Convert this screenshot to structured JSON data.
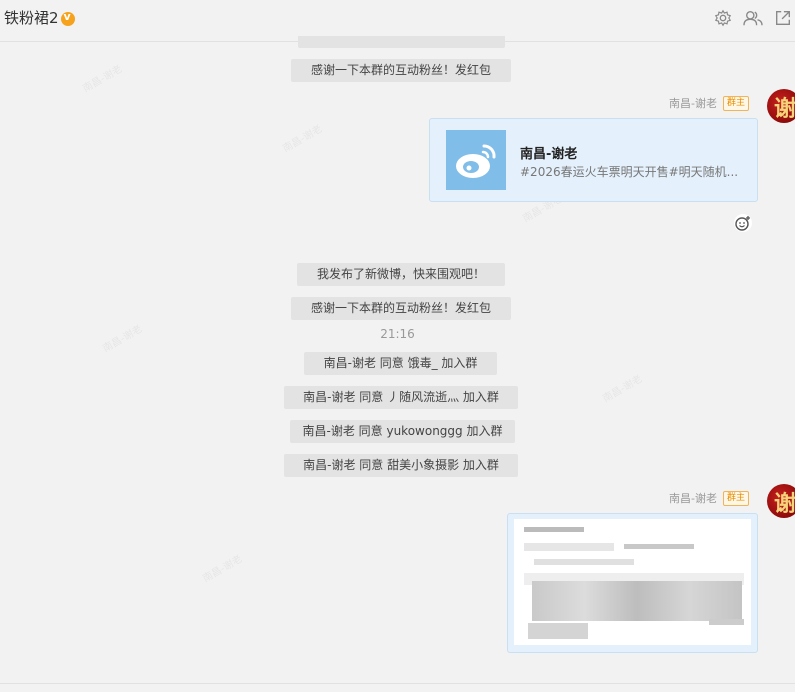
{
  "header": {
    "title": "铁粉裙2",
    "icons": [
      "settings-icon",
      "members-icon",
      "open-external-icon"
    ]
  },
  "messages": {
    "sys1": "感谢一下本群的互动粉丝！发红包",
    "sender1": "南昌-谢老",
    "role1": "群主",
    "avatar_text": "谢",
    "card": {
      "name": "南昌-谢老",
      "desc": "#2026春运火车票明天开售#明天随机..."
    },
    "sys2": "我发布了新微博，快来围观吧！",
    "sys3": "感谢一下本群的互动粉丝！发红包",
    "time": "21:16",
    "join1": "南昌-谢老 同意 饿毒_ 加入群",
    "join2": "南昌-谢老 同意 丿随风流逝灬 加入群",
    "join3": "南昌-谢老 同意 yukowonggg 加入群",
    "join4": "南昌-谢老 同意 甜美小象摄影 加入群",
    "sender2": "南昌-谢老",
    "role2": "群主"
  },
  "colors": {
    "background": "#f2f2f2",
    "system_bubble": "#e3e3e3",
    "card_bubble": "#e4f0fb",
    "role_badge": "#e88d00",
    "avatar": "#c8201e"
  }
}
